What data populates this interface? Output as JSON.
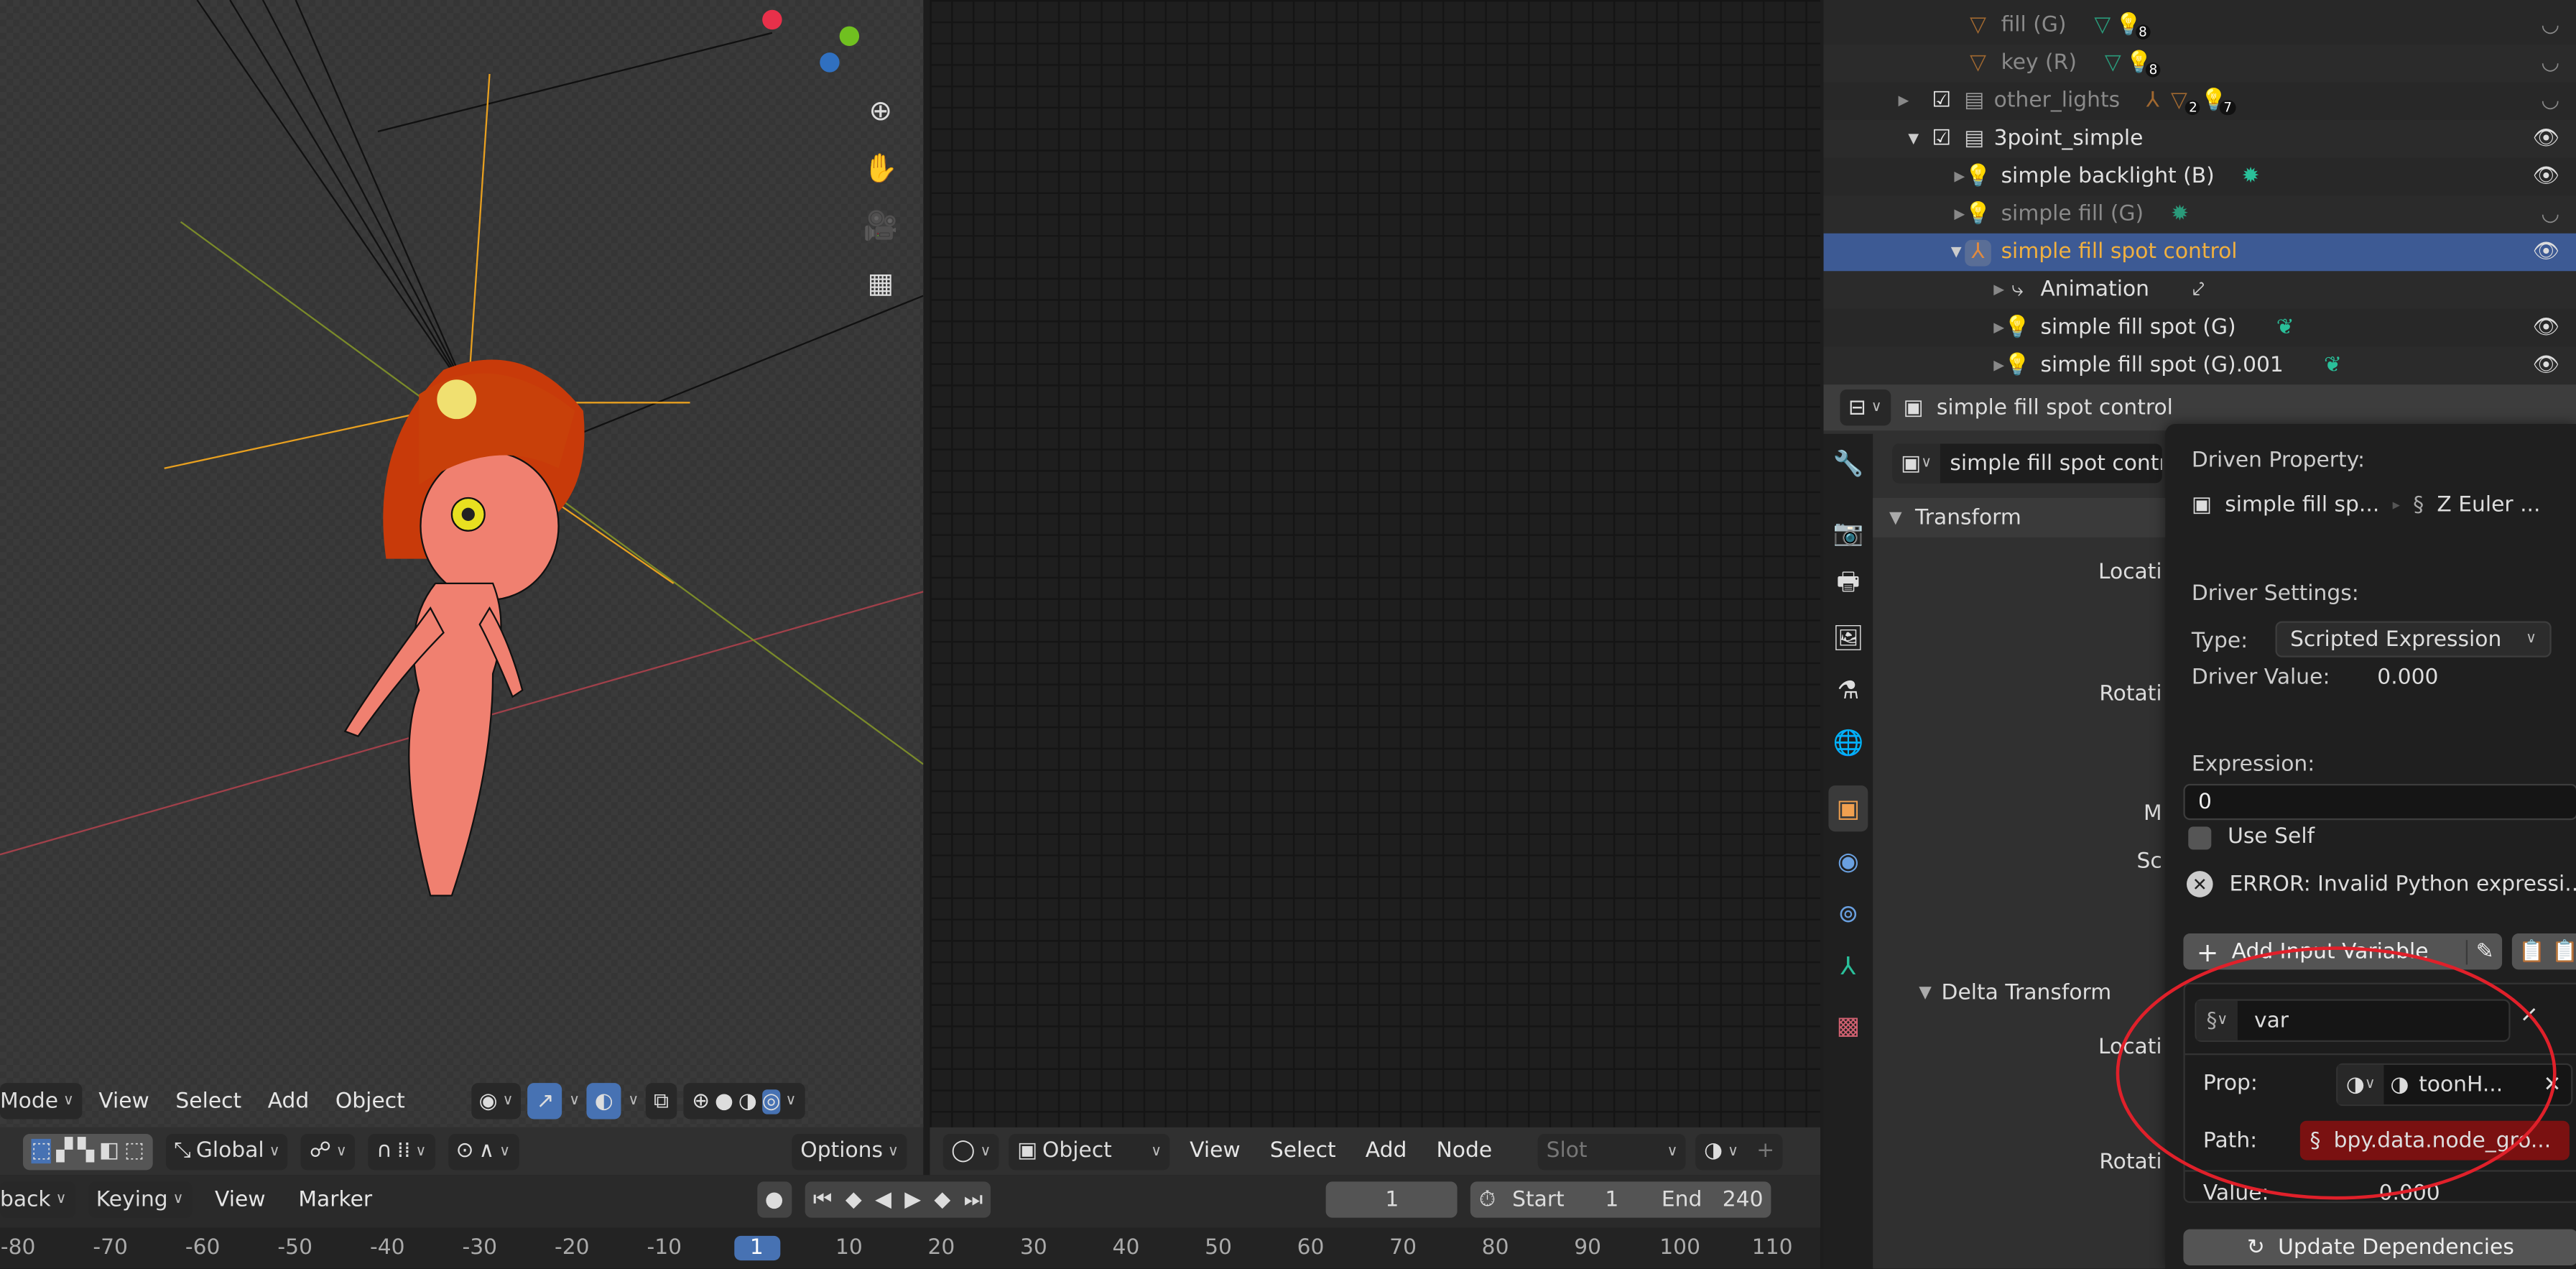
{
  "viewport": {
    "header": {
      "mode": "Mode",
      "menus": [
        "View",
        "Select",
        "Add",
        "Object"
      ]
    },
    "tool_header": {
      "orientation": "Global",
      "options": "Options"
    },
    "nav_icons": [
      "zoom-icon",
      "hand-pan-icon",
      "camera-icon",
      "grid-ortho-icon"
    ]
  },
  "node_editor": {
    "header": {
      "object_type": "Object",
      "menus": [
        "View",
        "Select",
        "Add",
        "Node"
      ],
      "slot": "Slot",
      "add": "+"
    }
  },
  "timeline": {
    "menus": [
      "back",
      "Keying",
      "View",
      "Marker"
    ],
    "current_frame": "1",
    "start_label": "Start",
    "start": "1",
    "end_label": "End",
    "end": "240",
    "ruler": [
      "-80",
      "-70",
      "-60",
      "-50",
      "-40",
      "-30",
      "-20",
      "-10",
      "1",
      "10",
      "20",
      "30",
      "40",
      "50",
      "60",
      "70",
      "80",
      "90",
      "100",
      "110"
    ],
    "playhead": "1"
  },
  "outliner": {
    "rows": [
      {
        "name": "fill (G)",
        "badge": "8",
        "style": "dim"
      },
      {
        "name": "key (R)",
        "badge": "8",
        "style": "dim"
      },
      {
        "name": "other_lights",
        "badge_a": "2",
        "badge_b": "7",
        "style": "dim"
      },
      {
        "name": "3point_simple",
        "style": "normal"
      },
      {
        "name": "simple backlight (B)",
        "style": "normal"
      },
      {
        "name": "simple fill (G)",
        "style": "dim"
      },
      {
        "name": "simple fill spot control",
        "style": "active"
      },
      {
        "name": "Animation",
        "style": "normal"
      },
      {
        "name": "simple fill spot (G)",
        "style": "normal"
      },
      {
        "name": "simple fill spot (G).001",
        "style": "normal"
      }
    ]
  },
  "properties": {
    "header_title": "simple fill spot control",
    "object_name": "simple fill spot contro",
    "transform_label": "Transform",
    "location_label": "Locati",
    "rotation_label": "Rotati",
    "mode_label": "M",
    "scale_label": "Sc",
    "delta_label": "Delta Transform",
    "delta_location_label": "Locati",
    "delta_rotation_label": "Rotati"
  },
  "driver": {
    "driven_property_label": "Driven Property:",
    "driven_object": "simple fill sp...",
    "driven_prop": "Z Euler ...",
    "settings_label": "Driver Settings:",
    "type_label": "Type:",
    "type_value": "Scripted Expression",
    "value_label": "Driver Value:",
    "value": "0.000",
    "expression_label": "Expression:",
    "expression": "0",
    "use_self": "Use Self",
    "error": "ERROR: Invalid Python expressi...",
    "add_variable": "Add Input Variable",
    "var_name": "var",
    "prop_label": "Prop:",
    "prop_value": "toonH...",
    "path_label": "Path:",
    "path_value": "bpy.data.node_gro...",
    "var_value_label": "Value:",
    "var_value": "0.000",
    "update_deps": "Update Dependencies",
    "error_color": "#7a1111",
    "annotation_color": "#e0202a"
  }
}
